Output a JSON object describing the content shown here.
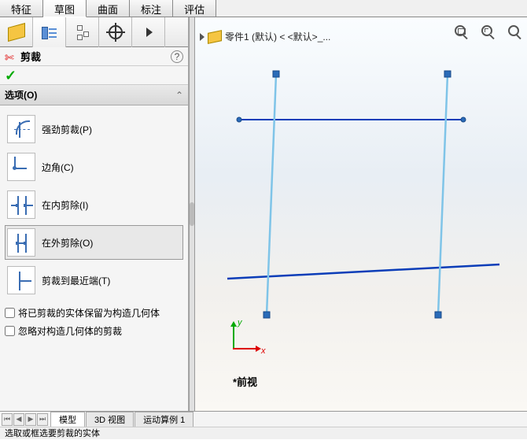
{
  "top_tabs": {
    "feature": "特征",
    "sketch": "草图",
    "surface": "曲面",
    "annotate": "标注",
    "evaluate": "评估"
  },
  "command": {
    "title": "剪裁",
    "ok_tooltip": "确定",
    "help": "?"
  },
  "options": {
    "header": "选项(O)",
    "power_trim": "强劲剪裁(P)",
    "corner": "边角(C)",
    "trim_inside": "在内剪除(I)",
    "trim_outside": "在外剪除(O)",
    "trim_nearest": "剪裁到最近端(T)"
  },
  "checkboxes": {
    "keep_as_construction": "将已剪裁的实体保留为构造几何体",
    "ignore_construction": "忽略对构造几何体的剪裁"
  },
  "graphics": {
    "document_name": "零件1 (默认) < <默认>_...",
    "view_label": "*前视",
    "axis_x": "x",
    "axis_y": "y"
  },
  "bottom_tabs": {
    "model": "模型",
    "view3d": "3D 视图",
    "motion": "运动算例 1"
  },
  "status": "选取或框选要剪裁的实体"
}
